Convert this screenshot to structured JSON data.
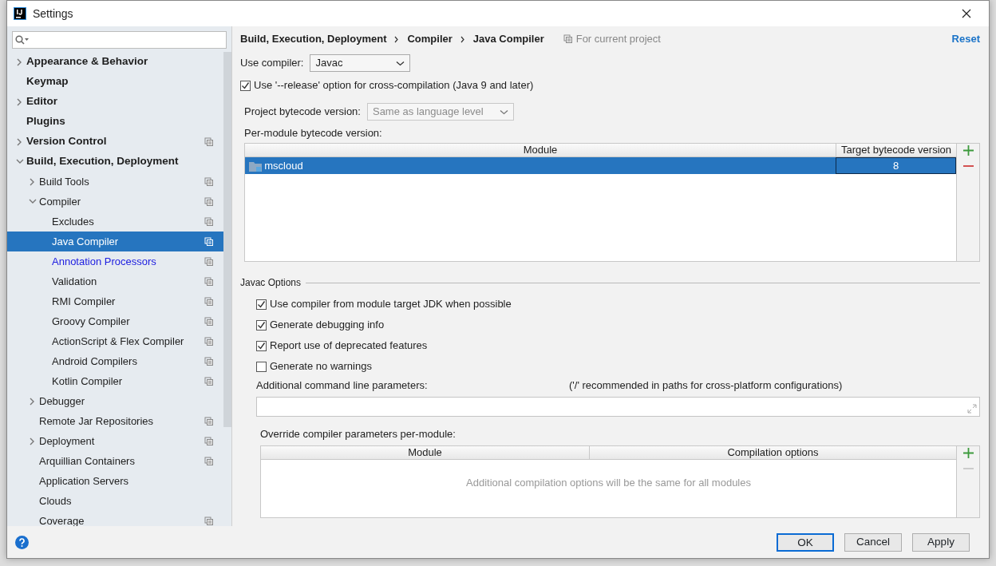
{
  "window": {
    "title": "Settings"
  },
  "sidebar": {
    "items": [
      {
        "label": "Appearance & Behavior",
        "expanded": false,
        "selected": false,
        "project_level": false
      },
      {
        "label": "Keymap",
        "selected": false,
        "project_level": false
      },
      {
        "label": "Editor",
        "expanded": false,
        "selected": false,
        "project_level": false
      },
      {
        "label": "Plugins",
        "selected": false,
        "project_level": false
      },
      {
        "label": "Version Control",
        "expanded": false,
        "selected": false,
        "project_level": true
      },
      {
        "label": "Build, Execution, Deployment",
        "expanded": true,
        "selected": false,
        "project_level": false,
        "children": [
          {
            "label": "Build Tools",
            "expanded": false,
            "selected": false,
            "project_level": true
          },
          {
            "label": "Compiler",
            "expanded": true,
            "selected": false,
            "project_level": true,
            "children": [
              {
                "label": "Excludes",
                "selected": false,
                "project_level": true
              },
              {
                "label": "Java Compiler",
                "selected": true,
                "project_level": true
              },
              {
                "label": "Annotation Processors",
                "selected": false,
                "project_level": true,
                "modified": true
              },
              {
                "label": "Validation",
                "selected": false,
                "project_level": true
              },
              {
                "label": "RMI Compiler",
                "selected": false,
                "project_level": true
              },
              {
                "label": "Groovy Compiler",
                "selected": false,
                "project_level": true
              },
              {
                "label": "ActionScript & Flex Compiler",
                "selected": false,
                "project_level": true
              },
              {
                "label": "Android Compilers",
                "selected": false,
                "project_level": true
              },
              {
                "label": "Kotlin Compiler",
                "selected": false,
                "project_level": true
              }
            ]
          },
          {
            "label": "Debugger",
            "expanded": false,
            "selected": false,
            "project_level": false
          },
          {
            "label": "Remote Jar Repositories",
            "selected": false,
            "project_level": true
          },
          {
            "label": "Deployment",
            "expanded": false,
            "selected": false,
            "project_level": true
          },
          {
            "label": "Arquillian Containers",
            "selected": false,
            "project_level": true
          },
          {
            "label": "Application Servers",
            "selected": false,
            "project_level": false
          },
          {
            "label": "Clouds",
            "selected": false,
            "project_level": false
          },
          {
            "label": "Coverage",
            "selected": false,
            "project_level": true
          }
        ]
      }
    ]
  },
  "breadcrumb": [
    "Build, Execution, Deployment",
    "Compiler",
    "Java Compiler"
  ],
  "scope": "For current project",
  "reset": "Reset",
  "use_compiler": {
    "label": "Use compiler:",
    "value": "Javac"
  },
  "release_option": {
    "label": "Use '--release' option for cross-compilation (Java 9 and later)",
    "checked": true
  },
  "project_bytecode": {
    "label": "Project bytecode version:",
    "value": "Same as language level",
    "disabled": true
  },
  "per_module": {
    "label": "Per-module bytecode version:",
    "columns": [
      "Module",
      "Target bytecode version"
    ],
    "rows": [
      {
        "module": "mscloud",
        "target": "8",
        "selected": true
      }
    ]
  },
  "javac_options": {
    "title": "Javac Options",
    "options": [
      {
        "label": "Use compiler from module target JDK when possible",
        "checked": true
      },
      {
        "label": "Generate debugging info",
        "checked": true
      },
      {
        "label": "Report use of deprecated features",
        "checked": true
      },
      {
        "label": "Generate no warnings",
        "checked": false
      }
    ],
    "params_label": "Additional command line parameters:",
    "params_hint": "('/' recommended in paths for cross-platform configurations)"
  },
  "override": {
    "label": "Override compiler parameters per-module:",
    "columns": [
      "Module",
      "Compilation options"
    ],
    "empty_text": "Additional compilation options will be the same for all modules"
  },
  "buttons": [
    {
      "label": "OK",
      "default": true
    },
    {
      "label": "Cancel",
      "default": false
    },
    {
      "label": "Apply",
      "default": false
    }
  ]
}
